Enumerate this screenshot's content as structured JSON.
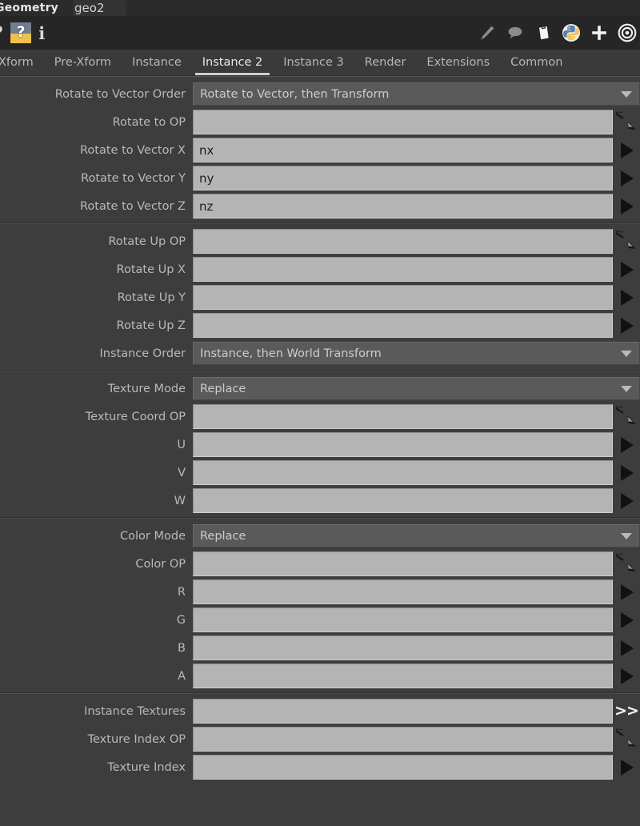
{
  "titlebar": {
    "node_type": "Geometry",
    "node_name": "geo2"
  },
  "toolbar": {
    "left_icons": [
      {
        "name": "help-question-plain-icon",
        "glyph": "?"
      },
      {
        "name": "help-question-highlight-icon",
        "glyph": "?"
      },
      {
        "name": "info-icon",
        "glyph": "i"
      }
    ],
    "right_icons": [
      {
        "name": "pencil-edit-icon"
      },
      {
        "name": "comment-bubble-icon"
      },
      {
        "name": "clipboard-icon"
      },
      {
        "name": "python-logo-icon"
      },
      {
        "name": "plus-add-icon"
      },
      {
        "name": "target-gimbal-icon"
      }
    ],
    "colors": {
      "python_blue": "#5a7fa8",
      "python_yellow": "#f2c55c",
      "help_blue": "#6f7f90",
      "help_yellow": "#f0c24b"
    }
  },
  "tabs": [
    {
      "label": "Xform",
      "active": false,
      "clipped": true
    },
    {
      "label": "Pre-Xform",
      "active": false,
      "clipped": false
    },
    {
      "label": "Instance",
      "active": false,
      "clipped": false
    },
    {
      "label": "Instance 2",
      "active": true,
      "clipped": false
    },
    {
      "label": "Instance 3",
      "active": false,
      "clipped": false
    },
    {
      "label": "Render",
      "active": false,
      "clipped": false
    },
    {
      "label": "Extensions",
      "active": false,
      "clipped": false
    },
    {
      "label": "Common",
      "active": false,
      "clipped": false
    }
  ],
  "groups": [
    {
      "rows": [
        {
          "label": "Rotate to Vector Order",
          "type": "menu",
          "value": "Rotate to Vector, then Transform",
          "gutter": "none"
        },
        {
          "label": "Rotate to OP",
          "type": "field",
          "value": "",
          "gutter": "jump"
        },
        {
          "label": "Rotate to Vector X",
          "type": "field",
          "value": "nx",
          "gutter": "play"
        },
        {
          "label": "Rotate to Vector Y",
          "type": "field",
          "value": "ny",
          "gutter": "play"
        },
        {
          "label": "Rotate to Vector Z",
          "type": "field",
          "value": "nz",
          "gutter": "play"
        }
      ]
    },
    {
      "rows": [
        {
          "label": "Rotate Up OP",
          "type": "field",
          "value": "",
          "gutter": "jump"
        },
        {
          "label": "Rotate Up X",
          "type": "field",
          "value": "",
          "gutter": "play"
        },
        {
          "label": "Rotate Up Y",
          "type": "field",
          "value": "",
          "gutter": "play"
        },
        {
          "label": "Rotate Up Z",
          "type": "field",
          "value": "",
          "gutter": "play"
        },
        {
          "label": "Instance Order",
          "type": "menu",
          "value": "Instance, then World Transform",
          "gutter": "none"
        }
      ]
    },
    {
      "rows": [
        {
          "label": "Texture Mode",
          "type": "menu",
          "value": "Replace",
          "gutter": "none"
        },
        {
          "label": "Texture Coord OP",
          "type": "field",
          "value": "",
          "gutter": "jump"
        },
        {
          "label": "U",
          "type": "field",
          "value": "",
          "gutter": "play"
        },
        {
          "label": "V",
          "type": "field",
          "value": "",
          "gutter": "play"
        },
        {
          "label": "W",
          "type": "field",
          "value": "",
          "gutter": "play"
        }
      ]
    },
    {
      "rows": [
        {
          "label": "Color Mode",
          "type": "menu",
          "value": "Replace",
          "gutter": "none"
        },
        {
          "label": "Color OP",
          "type": "field",
          "value": "",
          "gutter": "jump"
        },
        {
          "label": "R",
          "type": "field",
          "value": "",
          "gutter": "play"
        },
        {
          "label": "G",
          "type": "field",
          "value": "",
          "gutter": "play"
        },
        {
          "label": "B",
          "type": "field",
          "value": "",
          "gutter": "play"
        },
        {
          "label": "A",
          "type": "field",
          "value": "",
          "gutter": "play"
        }
      ]
    },
    {
      "rows": [
        {
          "label": "Instance Textures",
          "type": "field",
          "value": "",
          "gutter": "chev",
          "gutter_label": ">>"
        },
        {
          "label": "Texture Index OP",
          "type": "field",
          "value": "",
          "gutter": "jump"
        },
        {
          "label": "Texture Index",
          "type": "field",
          "value": "",
          "gutter": "play"
        }
      ]
    }
  ]
}
